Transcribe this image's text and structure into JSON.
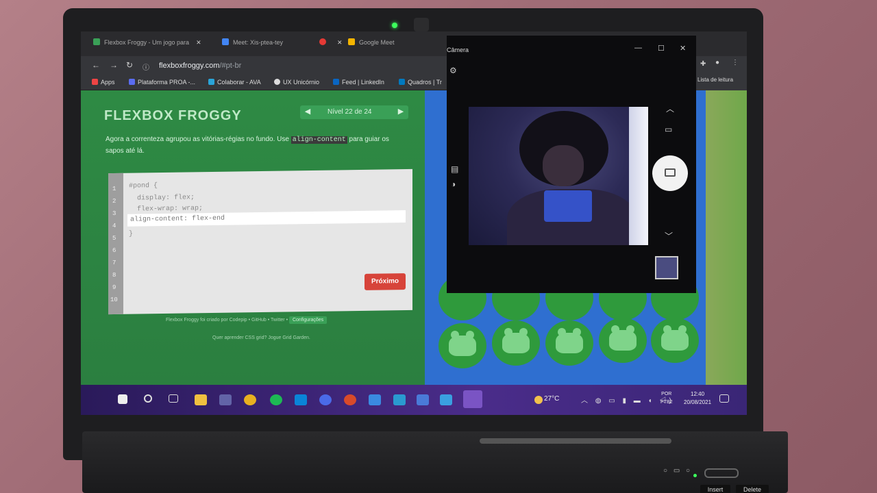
{
  "browser": {
    "tabs": [
      {
        "label": "Flexbox Froggy - Um jogo para",
        "close": "✕"
      },
      {
        "label": "Meet: Xis-ptea-tey",
        "close": "✕"
      },
      {
        "label": "Google Meet",
        "close": ""
      }
    ],
    "url_host": "flexboxfroggy.com",
    "url_path": "/#pt-br",
    "bookmarks": [
      "Apps",
      "Plataforma PROA -...",
      "Colaborar - AVA",
      "UX Unicórnio",
      "Feed | LinkedIn",
      "Quadros | Tr"
    ],
    "reading_list": "Lista de leitura"
  },
  "game": {
    "title": "FLEXBOX FROGGY",
    "level_label": "Nível 22 de 24",
    "level_prev": "◀",
    "level_next": "▶",
    "instruction_before": "Agora a correnteza agrupou as vitórias-régias no fundo. Use",
    "instruction_code": "align-content",
    "instruction_after": "para guiar os sapos até lá.",
    "line_numbers": [
      "1",
      "2",
      "3",
      "4",
      "5",
      "6",
      "7",
      "8",
      "9",
      "10"
    ],
    "code_lines": [
      "#pond {",
      "  display: flex;",
      "  flex-wrap: wrap;",
      "}"
    ],
    "answer": "align-content: flex-end",
    "next_button": "Próximo",
    "credits": "Flexbox Froggy foi criado por Codepip • GitHub • Twitter •",
    "settings_button": "Configurações",
    "learn_more": "Quer aprender CSS grid? Jogue Grid Garden."
  },
  "camera": {
    "title": "Câmera",
    "minimize": "—",
    "maximize": "☐",
    "close": "✕",
    "up_arrow": "︿",
    "down_arrow": "﹀"
  },
  "taskbar": {
    "temperature": "27°C",
    "language_top": "POR",
    "language_bottom": "PTB2",
    "time": "12:40",
    "date": "20/08/2021"
  }
}
